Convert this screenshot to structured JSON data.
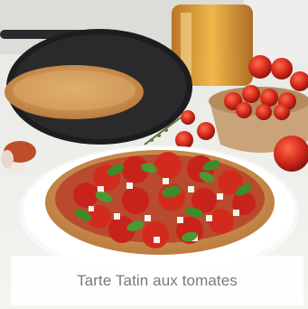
{
  "photo": {
    "subject_icon": "tarte-tatin-tomatoes-photo"
  },
  "caption": {
    "title": "Tarte Tatin aux tomates"
  },
  "colors": {
    "caption_text": "#7a7a7a",
    "caption_background": "#ffffff",
    "pan": "#1e1e20",
    "tomato": "#c8231b",
    "crust": "#d9a35f",
    "basil": "#3f8a2a"
  }
}
